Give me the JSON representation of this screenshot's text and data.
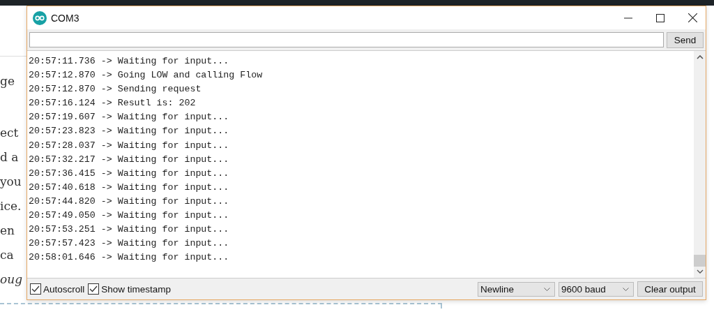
{
  "background_page": {
    "text_fragments": [
      {
        "text": "ge",
        "italic": false
      },
      {
        "text": "ect",
        "italic": false
      },
      {
        "text": "d a",
        "italic": false
      },
      {
        "text": "you",
        "italic": false
      },
      {
        "text": "ice.",
        "italic": false
      },
      {
        "text": "en",
        "italic": false
      },
      {
        "text": "ca",
        "italic": false
      },
      {
        "text": "oug",
        "italic": true
      }
    ]
  },
  "window": {
    "title": "COM3"
  },
  "send_button": "Send",
  "output_lines": [
    "20:57:11.736 -> Waiting for input...",
    "20:57:12.870 -> Going LOW and calling Flow",
    "20:57:12.870 -> Sending request",
    "20:57:16.124 -> Resutl is: 202",
    "20:57:19.607 -> Waiting for input...",
    "20:57:23.823 -> Waiting for input...",
    "20:57:28.037 -> Waiting for input...",
    "20:57:32.217 -> Waiting for input...",
    "20:57:36.415 -> Waiting for input...",
    "20:57:40.618 -> Waiting for input...",
    "20:57:44.820 -> Waiting for input...",
    "20:57:49.050 -> Waiting for input...",
    "20:57:53.251 -> Waiting for input...",
    "20:57:57.423 -> Waiting for input...",
    "20:58:01.646 -> Waiting for input..."
  ],
  "options": [
    {
      "label": "Autoscroll",
      "checked": true
    },
    {
      "label": "Show timestamp",
      "checked": true
    }
  ],
  "line_ending": "Newline",
  "baud_rate": "9600 baud",
  "clear_button": "Clear output"
}
